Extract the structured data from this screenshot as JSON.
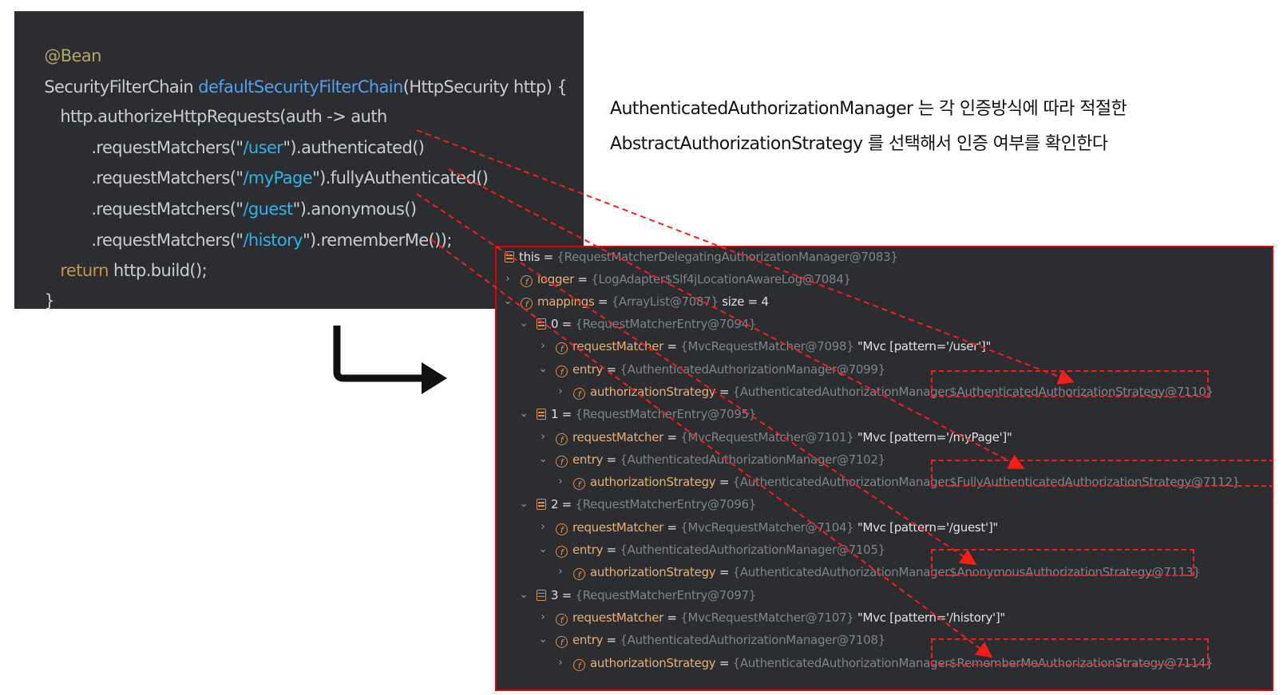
{
  "code": {
    "annotation": "@Bean",
    "line1": {
      "type": "SecurityFilterChain ",
      "method": "defaultSecurityFilterChain",
      "params": "(HttpSecurity http) {"
    },
    "line2": "http.authorizeHttpRequests(auth -> auth",
    "matchers": [
      {
        "prefix": ".requestMatchers(\"",
        "path": "/user",
        "suffix": "\").authenticated()"
      },
      {
        "prefix": ".requestMatchers(\"",
        "path": "/myPage",
        "suffix": "\").fullyAuthenticated()"
      },
      {
        "prefix": ".requestMatchers(\"",
        "path": "/guest",
        "suffix": "\").anonymous()"
      },
      {
        "prefix": ".requestMatchers(\"",
        "path": "/history",
        "suffix": "\").rememberMe());"
      }
    ],
    "return_kw": "return",
    "return_rest": " http.build();",
    "closing": "}"
  },
  "description": {
    "line1": "AuthenticatedAuthorizationManager 는 각 인증방식에 따라 적절한",
    "line2": "AbstractAuthorizationStrategy 를 선택해서 인증 여부를 확인한다"
  },
  "debugger": {
    "this": {
      "name": "this",
      "eq": " = ",
      "value": "{RequestMatcherDelegatingAuthorizationManager@7083}"
    },
    "logger": {
      "name": "logger",
      "eq": " = ",
      "value": "{LogAdapter$Slf4jLocationAwareLog@7084}"
    },
    "mappings": {
      "name": "mappings",
      "eq": " = ",
      "value": "{ArrayList@7087}",
      "size": "  size = 4"
    },
    "entries": [
      {
        "index": "0",
        "eq": " = ",
        "value": "{RequestMatcherEntry@7094}",
        "matcher_name": "requestMatcher",
        "matcher_value": "{MvcRequestMatcher@7098}",
        "matcher_str": " \"Mvc [pattern='/user']\"",
        "entry_name": "entry",
        "entry_value": "{AuthenticatedAuthorizationManager@7099}",
        "strategy_name": "authorizationStrategy",
        "strategy_value": "{AuthenticatedAuthorizationManager$AuthenticatedAuthorizationStrategy@7110}"
      },
      {
        "index": "1",
        "eq": " = ",
        "value": "{RequestMatcherEntry@7095}",
        "matcher_name": "requestMatcher",
        "matcher_value": "{MvcRequestMatcher@7101}",
        "matcher_str": " \"Mvc [pattern='/myPage']\"",
        "entry_name": "entry",
        "entry_value": "{AuthenticatedAuthorizationManager@7102}",
        "strategy_name": "authorizationStrategy",
        "strategy_value": "{AuthenticatedAuthorizationManager$FullyAuthenticatedAuthorizationStrategy@7112}"
      },
      {
        "index": "2",
        "eq": " = ",
        "value": "{RequestMatcherEntry@7096}",
        "matcher_name": "requestMatcher",
        "matcher_value": "{MvcRequestMatcher@7104}",
        "matcher_str": " \"Mvc [pattern='/guest']\"",
        "entry_name": "entry",
        "entry_value": "{AuthenticatedAuthorizationManager@7105}",
        "strategy_name": "authorizationStrategy",
        "strategy_value": "{AuthenticatedAuthorizationManager$AnonymousAuthorizationStrategy@7113}"
      },
      {
        "index": "3",
        "eq": " = ",
        "value": "{RequestMatcherEntry@7097}",
        "matcher_name": "requestMatcher",
        "matcher_value": "{MvcRequestMatcher@7107}",
        "matcher_str": " \"Mvc [pattern='/history']\"",
        "entry_name": "entry",
        "entry_value": "{AuthenticatedAuthorizationManager@7108}",
        "strategy_name": "authorizationStrategy",
        "strategy_value": "{AuthenticatedAuthorizationManager$RememberMeAuthorizationStrategy@7114}"
      }
    ]
  },
  "colors": {
    "highlight": "#ff1a1a",
    "code_bg": "#2b2d30",
    "field_icon": "#d7914f"
  },
  "icons": {
    "arrow": "turn-right-arrow-icon",
    "field": "field-icon",
    "list": "list-icon",
    "expand": "chevron-icon"
  }
}
